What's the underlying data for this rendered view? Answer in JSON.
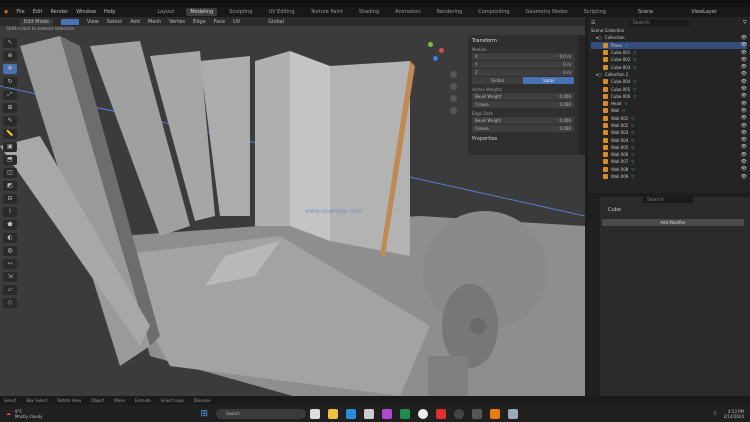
{
  "menubar": {
    "menus": [
      "File",
      "Edit",
      "Render",
      "Window",
      "Help"
    ],
    "workspaces": [
      "Layout",
      "Modeling",
      "Sculpting",
      "UV Editing",
      "Texture Paint",
      "Shading",
      "Animation",
      "Rendering",
      "Compositing",
      "Geometry Nodes",
      "Scripting"
    ],
    "active_workspace": "Modeling",
    "scene": "Scene",
    "view_layer": "ViewLayer"
  },
  "header": {
    "mode": "Edit Mode",
    "items": [
      "View",
      "Select",
      "Add",
      "Mesh",
      "Vertex",
      "Edge",
      "Face",
      "UV"
    ],
    "orientation": "Global"
  },
  "viewport": {
    "hint": "Shift+click to extend selection",
    "overlay_text": "www.example.com"
  },
  "npanel": {
    "title": "Transform",
    "section": "Median",
    "x_label": "X",
    "x_value": "0.0 m",
    "y_label": "Y",
    "y_value": "0 m",
    "z_label": "Z",
    "z_value": "0 m",
    "global": "Global",
    "local": "Local",
    "vertex_weights": "Vertex Weights",
    "bevel": "Bevel Weight",
    "bevel_value": "0.000",
    "crease": "Crease",
    "crease_value": "0.000",
    "edge_data": "Edge Data",
    "edge_bevel": "Bevel Weight",
    "edge_bevel_value": "0.000",
    "edge_crease": "Crease",
    "edge_crease_value": "0.000",
    "properties": "Properties"
  },
  "outliner": {
    "search_placeholder": "Search",
    "root": "Scene Collection",
    "collections": [
      {
        "name": "Collection",
        "items": [
          "Plane",
          "Cube.001",
          "Cube.002",
          "Cube.003"
        ]
      },
      {
        "name": "Collection 2",
        "items": [
          "Cube.004",
          "Cube.005",
          "Cube.006",
          "Head",
          "Wall",
          "Wall.001",
          "Wall.002",
          "Wall.003",
          "Wall.004",
          "Wall.005",
          "Wall.006",
          "Wall.007",
          "Wall.008",
          "Wall.009"
        ]
      }
    ]
  },
  "properties": {
    "search_placeholder": "Search",
    "object": "Cube",
    "button": "Add Modifier"
  },
  "status": [
    "Select",
    "Box Select",
    "Rotate View",
    "Object",
    "Move",
    "Extrude",
    "Select Loop",
    "Dissolve"
  ],
  "taskbar": {
    "weather_temp": "9°C",
    "weather_text": "Mostly cloudy",
    "search": "Search",
    "time": "4:53 PM",
    "date": "2/14/2024",
    "accent": "#4772b3"
  }
}
